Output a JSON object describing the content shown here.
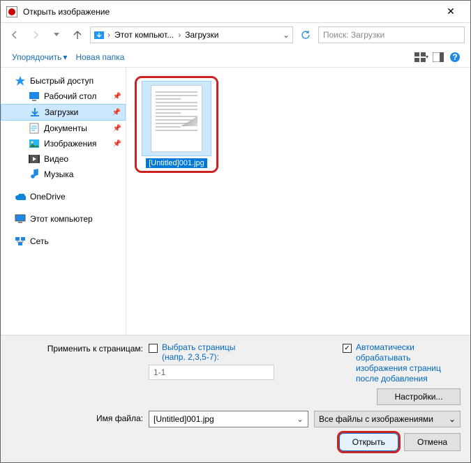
{
  "title": "Открыть изображение",
  "breadcrumb": {
    "root": "Этот компьют...",
    "folder": "Загрузки"
  },
  "search": {
    "placeholder": "Поиск: Загрузки"
  },
  "toolbar": {
    "organize": "Упорядочить",
    "newfolder": "Новая папка"
  },
  "sidebar": {
    "quick": "Быстрый доступ",
    "desktop": "Рабочий стол",
    "downloads": "Загрузки",
    "documents": "Документы",
    "pictures": "Изображения",
    "videos": "Видео",
    "music": "Музыка",
    "onedrive": "OneDrive",
    "thispc": "Этот компьютер",
    "network": "Сеть"
  },
  "file": {
    "name": "[Untitled]001.jpg"
  },
  "bottom": {
    "pages_label": "Применить к страницам:",
    "select_pages": "Выбрать страницы",
    "hint": "(напр. 2,3,5-7):",
    "range": "1-1",
    "auto": "Автоматически обрабатывать изображения страниц после добавления",
    "settings": "Настройки...",
    "filename_label": "Имя файла:",
    "filter": "Все файлы с изображениями",
    "open": "Открыть",
    "cancel": "Отмена"
  }
}
